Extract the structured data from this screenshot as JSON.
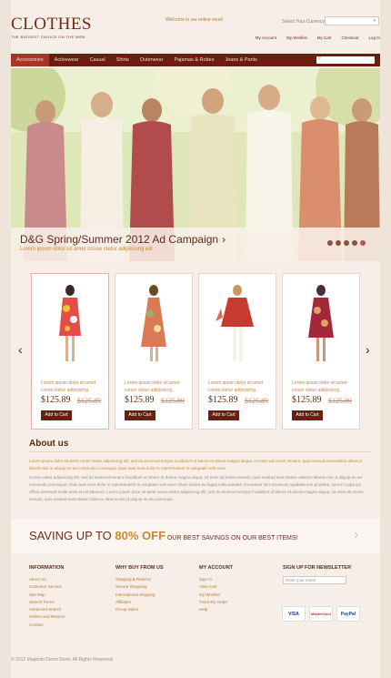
{
  "header": {
    "logo": "CLOTHES",
    "tagline": "THE BIGGEST CHOICE ON THE WEB",
    "welcome": "Welcome to our online store!",
    "currency_label": "Select Your Currency",
    "currency_value": "",
    "top_links": [
      "My Account",
      "My Wishlist",
      "My Cart",
      "Checkout",
      "Log In"
    ]
  },
  "nav": {
    "items": [
      "Accessories",
      "Activewear",
      "Casual",
      "Shirts",
      "Outerwear",
      "Pajamas & Robes",
      "Jeans & Pants"
    ],
    "active_index": 0,
    "search_placeholder": ""
  },
  "hero": {
    "title": "D&G Spring/Summer 2012 Ad Campaign",
    "arrow": "›",
    "subtitle": "Lorem ipsum dolor sit amet conse ctetur adipisicing elit",
    "slides": 5,
    "active_slide": 4
  },
  "products": {
    "prev_arrow": "‹",
    "next_arrow": "›",
    "items": [
      {
        "name": "Lorem ipsum dolor sit amet conse ctetur adipisicing",
        "price": "$125.89",
        "old_price": "$125.89",
        "button": "Add to Cart",
        "colors": [
          "#e84b4b",
          "#f3c236",
          "#ffffff"
        ]
      },
      {
        "name": "Lorem ipsum dolor sit amet conse ctetur adipisicing",
        "price": "$125.89",
        "old_price": "$125.89",
        "button": "Add to Cart",
        "colors": [
          "#d97a55",
          "#9bb26a",
          "#f1d9a8"
        ]
      },
      {
        "name": "Lorem ipsum dolor sit amet conse ctetur adipisicing",
        "price": "$125.89",
        "old_price": "$125.89",
        "button": "Add to Cart",
        "colors": [
          "#c73a2e",
          "#f5f1ea",
          "#e06b4a"
        ]
      },
      {
        "name": "Lorem ipsum dolor sit amet conse ctetur adipisicing",
        "price": "$125.89",
        "old_price": "$125.89",
        "button": "Add to Cart",
        "colors": [
          "#a5283a",
          "#d8a46a",
          "#4a2c3a"
        ]
      }
    ]
  },
  "about": {
    "title": "About us",
    "lead": "Lorem ipsum dolor sit amet conse ctetur adipisicing elit, sed do eiusmod tempor incididunt ut labore et dolore magna aliqua. Ut enim ad minim veniam, quis nostrud exercitation ullamco laboris nisi ut aliquip ex ea commodo consequat. Duis aute irure dolor in reprehenderit in voluptate velit esse.",
    "body": "Conse ctetur adipisicing elit, sed do eiusmod tempor incididunt ut labore et dolore magna aliqua. Ut enim ad minim veniam, quis nostrud exercitation ullamco laboris nisi ut aliquip ex ea commodo consequat. Duis aute irure dolor in reprehenderit in voluptate velit esse cillum dolore eu fugiat nulla pariatur. Excepteur sint occaecat cupidatat non proident, sunt in culpa qui officia deserunt mollit anim id est laborum. Lorem ipsum dolor sit amet conse ctetur adipisicing elit, sed do eiusmod tempor incididunt ut labore et dolore magna aliqua. Ut enim ad minim veniam, quis nostrud exercitation ullamco laboris nisi ut aliquip ex ea commodo."
  },
  "saving": {
    "prefix": "SAVING UP TO ",
    "highlight": "80% OFF",
    "suffix": " OUR BEST SAVINGS ON OUR BEST ITEMS!",
    "arrow": "›"
  },
  "footer": {
    "information": {
      "title": "INFORMATION",
      "links": [
        "About Us",
        "Customer Service",
        "Site Map",
        "Search Terms",
        "Advanced Search",
        "Orders and Returns",
        "Contact"
      ]
    },
    "why_buy": {
      "title": "WHY BUY FROM US",
      "links": [
        "Shipping & Returns",
        "Secure Shopping",
        "International Shipping",
        "Affiliates",
        "Group Sales"
      ]
    },
    "my_account": {
      "title": "MY ACCOUNT",
      "links": [
        "Sign In",
        "View Cart",
        "My Wishlist",
        "Track My Order",
        "Help"
      ]
    },
    "newsletter": {
      "title": "SIGN UP FOR NEWSLETTER",
      "placeholder": "Enter your email"
    },
    "payments": [
      "VISA",
      "MasterCard",
      "PayPal"
    ],
    "copyright": "© 2012 Magento Demo Store. All Rights Reserved."
  },
  "colors": {
    "accent": "#6b1d10",
    "highlight": "#c8892e",
    "active_tab": "#a6362a"
  }
}
